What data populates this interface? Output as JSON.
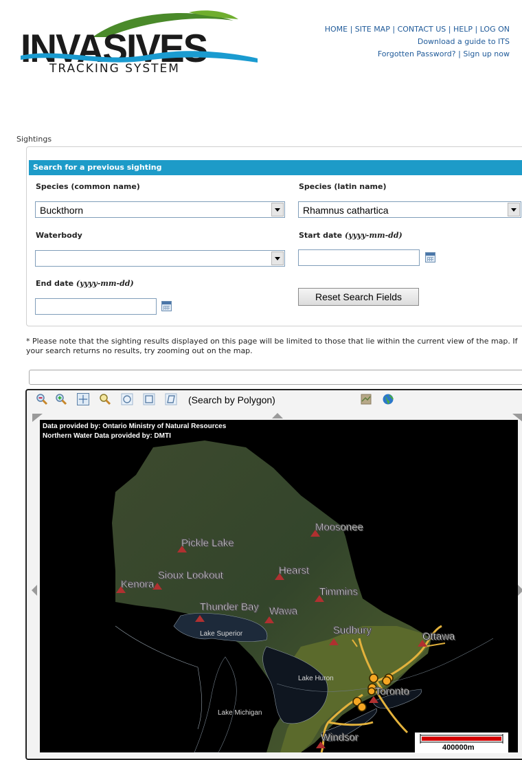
{
  "logo": {
    "word": "INVASIVES",
    "subtitle": "TRACKING SYSTEM"
  },
  "header_links": {
    "row1": [
      "HOME",
      "SITE MAP",
      "CONTACT US",
      "HELP",
      "LOG ON"
    ],
    "row2": "Download a guide to ITS",
    "row3": [
      "Forgotten Password?",
      "Sign up now"
    ]
  },
  "section_label": "Sightings",
  "search": {
    "header": "Search for a previous sighting",
    "species_common_label": "Species (common name)",
    "species_common_value": "Buckthorn",
    "species_latin_label": "Species (latin name)",
    "species_latin_value": "Rhamnus cathartica",
    "waterbody_label": "Waterbody",
    "waterbody_value": "",
    "start_date_label": "Start date",
    "start_date_format": "(yyyy-mm-dd)",
    "start_date_value": "",
    "end_date_label": "End date",
    "end_date_format": "(yyyy-mm-dd)",
    "end_date_value": "",
    "reset_label": "Reset Search Fields"
  },
  "note": "* Please note that the sighting results displayed on this page will be limited to those that lie within the current view of the map. If your search returns no results, try zooming out on the map.",
  "map": {
    "toolbar": {
      "tools": [
        "zoom-out-icon",
        "zoom-in-icon",
        "pan-icon",
        "identify-icon",
        "circle-select-icon",
        "rectangle-select-icon",
        "polygon-select-icon",
        "aerial-layer-icon",
        "globe-icon"
      ],
      "polygon_label": "(Search by Polygon)"
    },
    "credits": [
      "Data provided by: Ontario Ministry of Natural Resources",
      "Northern Water Data provided by: DMTI"
    ],
    "cities": [
      "Moosonee",
      "Pickle Lake",
      "Hearst",
      "Sioux Lookout",
      "Kenora",
      "Timmins",
      "Thunder Bay",
      "Wawa",
      "Sudbury",
      "Ottawa",
      "Toronto",
      "Windsor"
    ],
    "lakes": [
      "Lake Superior",
      "Lake Huron",
      "Lake Michigan"
    ],
    "scale_label": "400000m",
    "colors": {
      "sighting": "#f5a623",
      "city_marker": "#b03030",
      "road": "#e3b23c",
      "header": "#1d9bc8"
    }
  }
}
